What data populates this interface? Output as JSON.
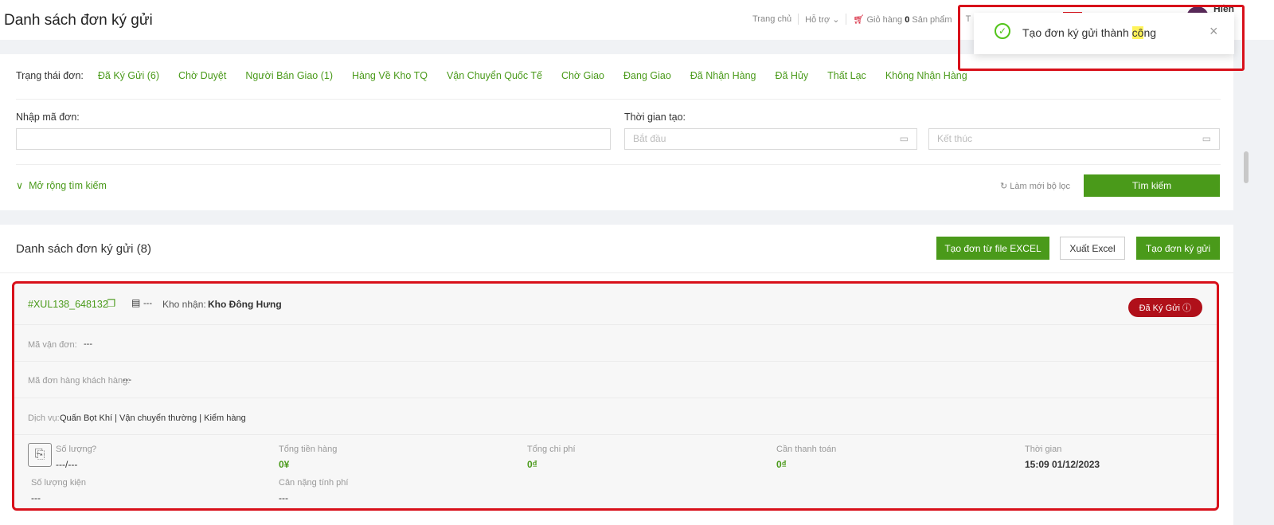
{
  "header": {
    "title": "Danh sách đơn ký gửi",
    "nav": {
      "home": "Trang chủ",
      "support": "Hỗ trợ",
      "cart_label": "Giỏ hàng",
      "cart_count": "0",
      "cart_unit": "Sản phẩm",
      "truncated": "T"
    },
    "user_name": "Hiền"
  },
  "toast": {
    "message_prefix": "Tạo đơn ký gửi thành ",
    "message_highlight": "cô",
    "message_suffix": "ng",
    "close": "×"
  },
  "filter": {
    "status_label": "Trạng thái đơn:",
    "tabs": [
      "Đã Ký Gửi (6)",
      "Chờ Duyệt",
      "Người Bán Giao (1)",
      "Hàng Về Kho TQ",
      "Vận Chuyển Quốc Tế",
      "Chờ Giao",
      "Đang Giao",
      "Đã Nhận Hàng",
      "Đã Hủy",
      "Thất Lạc",
      "Không Nhận Hàng"
    ],
    "code_label": "Nhập mã đơn:",
    "code_value": "",
    "time_label": "Thời gian tạo:",
    "start_placeholder": "Bắt đầu",
    "end_placeholder": "Kết thúc",
    "expand": "Mở rộng tìm kiếm",
    "reset": "Làm mới bộ lọc",
    "search": "Tìm kiếm"
  },
  "list": {
    "title": "Danh sách đơn ký gửi (8)",
    "btn_excel_create": "Tạo đơn từ file EXCEL",
    "btn_export": "Xuất Excel",
    "btn_create": "Tạo đơn ký gửi",
    "order": {
      "code": "#XUL138_648132",
      "store": "---",
      "warehouse_label": "Kho nhận:",
      "warehouse": "Kho Đông Hưng",
      "status": "Đã Ký Gửi",
      "waybill_label": "Mã vận đơn:",
      "waybill": "---",
      "customer_code_label": "Mã đơn hàng khách hàng:",
      "customer_code": "---",
      "service_label": "Dịch vụ:",
      "services": "Quấn Bọt Khí | Vận chuyển thường | Kiểm hàng",
      "qty_label": "Số lượng",
      "qty": "---/---",
      "total_goods_label": "Tổng tiền hàng",
      "total_goods": "0¥",
      "total_cost_label": "Tổng chi phí",
      "total_cost": "0₫",
      "to_pay_label": "Cần thanh toán",
      "to_pay": "0₫",
      "time_label": "Thời gian",
      "time": "15:09 01/12/2023",
      "packages_label": "Số lượng kiện",
      "packages": "---",
      "weight_label": "Cân nặng tính phí",
      "weight": "---"
    }
  },
  "colors": {
    "accent": "#4a9a1a",
    "status_badge": "#b0101a",
    "highlight": "#d8101a"
  }
}
